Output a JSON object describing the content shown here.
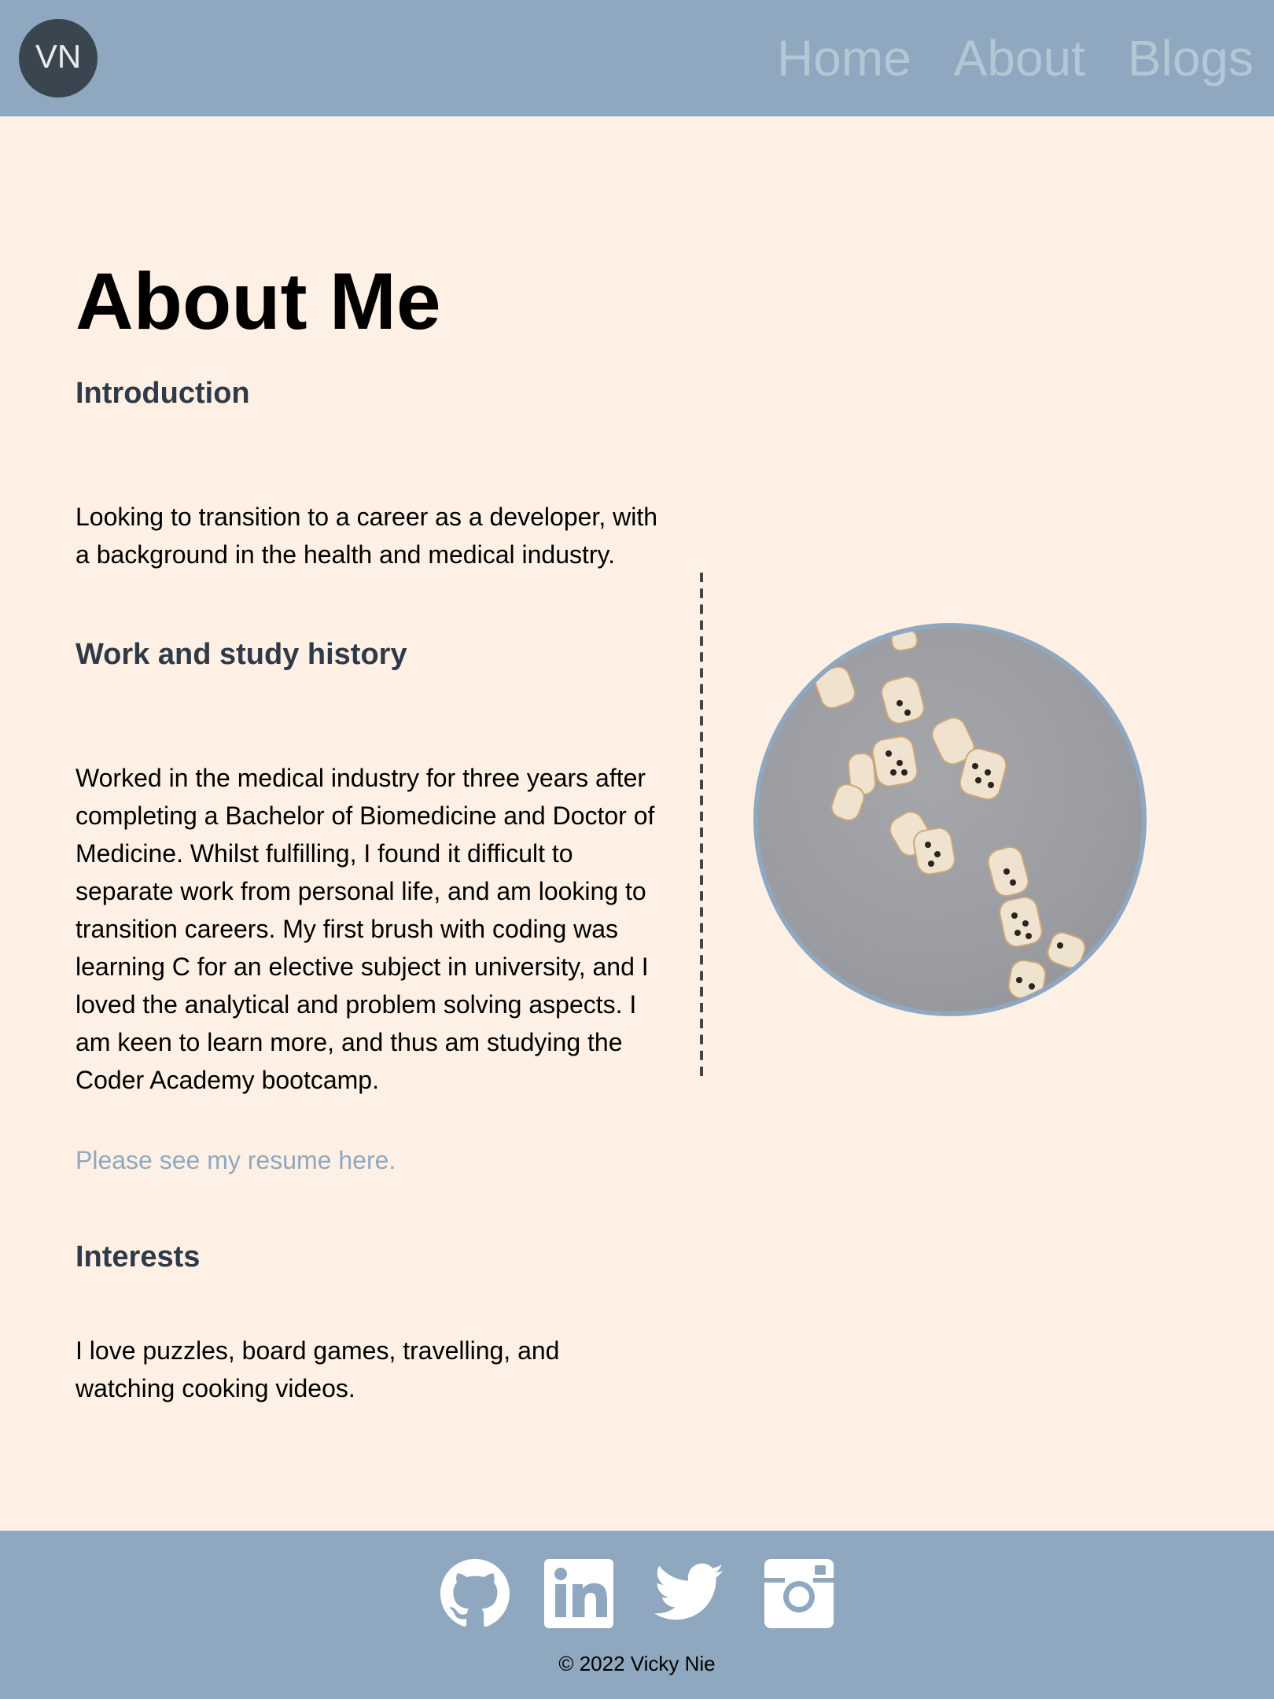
{
  "header": {
    "logo_text": "VN",
    "nav": [
      {
        "label": "Home"
      },
      {
        "label": "About"
      },
      {
        "label": "Blogs"
      }
    ]
  },
  "main": {
    "title": "About Me",
    "sections": {
      "intro_heading": "Introduction",
      "intro_text": "Looking to transition to a career as a developer, with a background in the health and medical industry.",
      "work_heading": "Work and study history",
      "work_text": "Worked in the medical industry for three years after completing a Bachelor of Biomedicine and Doctor of Medicine. Whilst fulfilling, I found it difficult to separate work from personal life, and am looking to transition careers. My first brush with coding was learning C for an elective subject in university, and I loved the analytical and problem solving aspects. I am keen to learn more, and thus am studying the Coder Academy bootcamp.",
      "resume_link": "Please see my resume here.",
      "interests_heading": "Interests",
      "interests_text": "I love puzzles, board games, travelling, and watching cooking videos."
    },
    "photo_icon": "dice-photo"
  },
  "footer": {
    "socials": [
      {
        "icon": "github-icon"
      },
      {
        "icon": "linkedin-icon"
      },
      {
        "icon": "twitter-icon"
      },
      {
        "icon": "instagram-icon"
      }
    ],
    "copyright": "© 2022 Vicky Nie"
  },
  "colors": {
    "header_bg": "#8fa8bf",
    "main_bg": "#fef0e4",
    "logo_bg": "#3a4550",
    "nav_text": "#b5c6d5",
    "heading_text": "#2e3a48",
    "link_text": "#8fa8bf"
  }
}
